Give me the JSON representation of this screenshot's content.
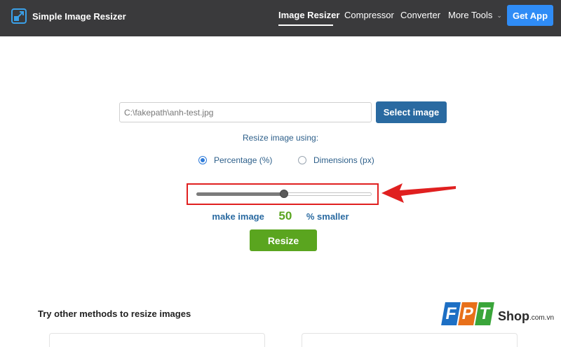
{
  "header": {
    "brand": "Simple Image Resizer",
    "nav": [
      {
        "label": "Image Resizer",
        "active": true
      },
      {
        "label": "Compressor",
        "active": false
      },
      {
        "label": "Converter",
        "active": false
      },
      {
        "label": "More Tools",
        "active": false
      }
    ],
    "get_app": "Get App"
  },
  "uploader": {
    "file_value": "C:\\fakepath\\anh-test.jpg",
    "select_button": "Select image"
  },
  "resize_using_label": "Resize image using:",
  "options": {
    "percentage": "Percentage (%)",
    "dimensions": "Dimensions (px)",
    "selected": "percentage"
  },
  "slider": {
    "value_fraction": 0.5
  },
  "make_row": {
    "prefix": "make image",
    "value": "50",
    "suffix": "% smaller"
  },
  "resize_button": "Resize",
  "other_methods_title": "Try other methods to resize images",
  "watermark": {
    "letters": [
      "F",
      "P",
      "T"
    ],
    "shop": "Shop",
    "domain": ".com.vn"
  },
  "colors": {
    "header_bg": "#3a3a3c",
    "accent_blue": "#2a6aa1",
    "get_app_blue": "#2f8cf6",
    "green": "#5aa51f",
    "highlight_red": "#e02020"
  }
}
